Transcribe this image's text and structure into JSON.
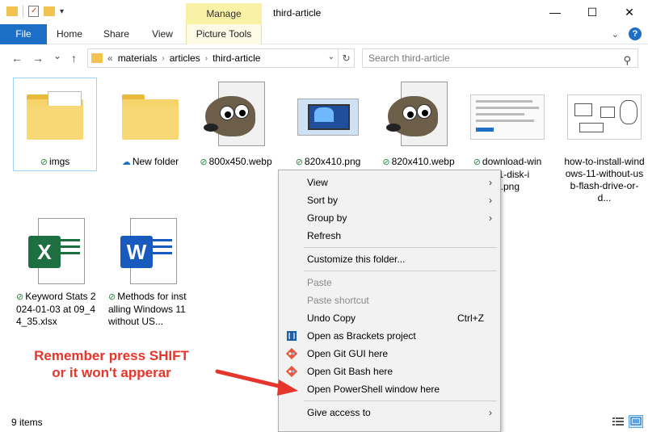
{
  "window": {
    "manage_tab": "Manage",
    "title": "third-article",
    "minimize": "—",
    "maximize": "☐",
    "close": "✕"
  },
  "ribbon": {
    "file": "File",
    "tabs": [
      "Home",
      "Share",
      "View",
      "Picture Tools"
    ]
  },
  "nav": {
    "back": "←",
    "forward": "→",
    "recent": "⌄",
    "up": "↑",
    "breadcrumb": [
      "«",
      "materials",
      "articles",
      "third-article"
    ],
    "refresh": "↻",
    "search_placeholder": "Search third-article"
  },
  "items": [
    {
      "label": "imgs",
      "status": "synced",
      "icon": "folder-icon"
    },
    {
      "label": "New folder",
      "status": "cloud",
      "icon": "folder-icon"
    },
    {
      "label": "800x450.webp",
      "status": "synced",
      "icon": "gimp-icon"
    },
    {
      "label": "820x410.png",
      "status": "synced",
      "icon": "image-thumbnail"
    },
    {
      "label": "820x410.webp",
      "status": "synced",
      "icon": "gimp-icon"
    },
    {
      "label": "download-windows-11-disk-image.png",
      "label_visible_l1": "download-win",
      "label_visible_l2": "s-11-disk-i",
      "label_visible_l3": "e.png",
      "status": "synced",
      "icon": "screenshot-thumbnail"
    },
    {
      "label": "how-to-install-windows-11-without-usb-flash-drive-or-d...",
      "status": "none",
      "icon": "diagram-thumbnail"
    },
    {
      "label": "Keyword Stats 2024-01-03 at 09_44_35.xlsx",
      "status": "synced",
      "icon": "excel-icon"
    },
    {
      "label": "Methods for installing Windows 11 without US...",
      "status": "synced",
      "icon": "word-icon"
    }
  ],
  "context_menu": {
    "items": [
      {
        "label": "View",
        "submenu": true,
        "enabled": true
      },
      {
        "label": "Sort by",
        "submenu": true,
        "enabled": true
      },
      {
        "label": "Group by",
        "submenu": true,
        "enabled": true
      },
      {
        "label": "Refresh",
        "enabled": true
      },
      {
        "separator": true
      },
      {
        "label": "Customize this folder...",
        "enabled": true
      },
      {
        "separator": true
      },
      {
        "label": "Paste",
        "enabled": false
      },
      {
        "label": "Paste shortcut",
        "enabled": false
      },
      {
        "label": "Undo Copy",
        "shortcut": "Ctrl+Z",
        "enabled": true
      },
      {
        "label": "Open as Brackets project",
        "icon": "brackets-icon",
        "enabled": true
      },
      {
        "label": "Open Git GUI here",
        "icon": "git-icon",
        "enabled": true
      },
      {
        "label": "Open Git Bash here",
        "icon": "git-icon",
        "enabled": true
      },
      {
        "label": "Open PowerShell window here",
        "enabled": true
      },
      {
        "separator": true
      },
      {
        "label": "Give access to",
        "submenu": true,
        "enabled": true
      }
    ]
  },
  "annotation": {
    "line1": "Remember press SHIFT",
    "line2": "or it won't apperar",
    "color": "#e6352b"
  },
  "status": {
    "count": "9 items"
  },
  "colors": {
    "file_tab": "#1c6fc5",
    "manage_tab": "#f9f1a5",
    "sync_green": "#1d8b3a",
    "excel_green": "#1d6f42",
    "word_blue": "#185abd"
  }
}
